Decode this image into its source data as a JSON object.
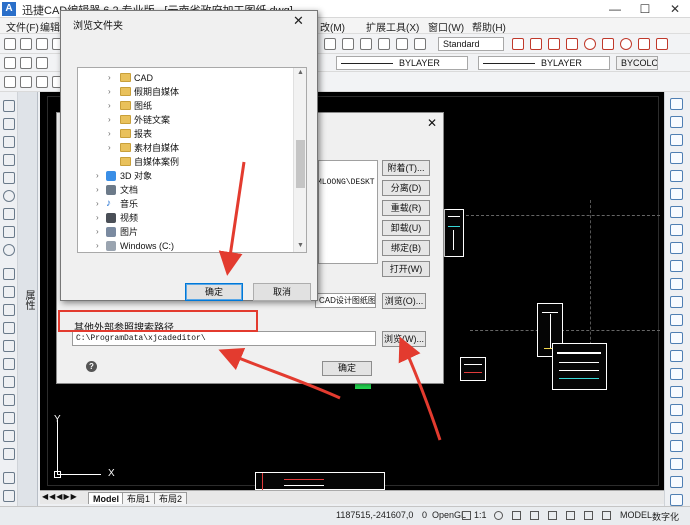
{
  "app": {
    "title_visible": "迅捷CAD编辑器 6.2 专业版 - [云南省政府加工图纸.dwg]"
  },
  "menu": [
    "文件(F)",
    "编辑",
    "改(M)",
    "扩展工具(X)",
    "窗口(W)",
    "帮助(H)"
  ],
  "toolbar": {
    "text_style": "Standard",
    "layer1": "BYLAYER",
    "layer2": "BYLAYER",
    "color": "BYCOLOR"
  },
  "properties_panel": {
    "label": "属性"
  },
  "browse_dialog": {
    "title": "浏览文件夹",
    "tree": [
      {
        "label": "CAD",
        "type": "folder"
      },
      {
        "label": "假期自媒体",
        "type": "folder"
      },
      {
        "label": "图纸",
        "type": "folder"
      },
      {
        "label": "外链文案",
        "type": "folder"
      },
      {
        "label": "报表",
        "type": "folder"
      },
      {
        "label": "素材自媒体",
        "type": "folder"
      },
      {
        "label": "自媒体案例",
        "type": "folder"
      },
      {
        "label": "3D 对象",
        "type": "3d"
      },
      {
        "label": "文档",
        "type": "docs"
      },
      {
        "label": "音乐",
        "type": "music"
      },
      {
        "label": "视频",
        "type": "video"
      },
      {
        "label": "图片",
        "type": "pictures"
      },
      {
        "label": "Windows (C:)",
        "type": "drive"
      }
    ],
    "ok_label": "确定",
    "cancel_label": "取消"
  },
  "xref_dialog": {
    "path_partial": "MLOONG\\DESKT",
    "buttons": [
      "附着(T)...",
      "分离(D)",
      "重载(R)",
      "卸载(U)",
      "绑定(B)",
      "打开(W)"
    ],
    "source_field": "CAD设计图纸图",
    "browse1": "浏览(O)...",
    "section_label": "其他外部参照搜索路径",
    "search_path": "C:\\ProgramData\\xjcadeditor\\",
    "browse2": "浏览(W)...",
    "ok_label": "确定"
  },
  "canvas": {
    "axis_y": "Y",
    "axis_x": "X",
    "tabs": [
      "Model",
      "布局1",
      "布局2"
    ]
  },
  "status": {
    "coords": "1187515,-241607,0",
    "zero": "0",
    "opengl": "OpenGL",
    "scale": "1:1",
    "model": "MODEL",
    "digitizer": "数字化"
  },
  "colors": {
    "annotation_red": "#e33b2f",
    "canvas_bg": "#000000",
    "accent_blue": "#0078d7"
  }
}
